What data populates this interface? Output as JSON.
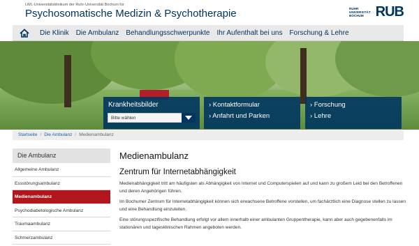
{
  "header": {
    "institution": "LWL-Universitätsklinikum der Ruhr-Universität Bochum für",
    "title": "Psychosomatische Medizin & Psychotherapie",
    "logo_small": "RUHR UNIVERSITÄT BOCHUM",
    "logo_big": "RUB"
  },
  "nav": {
    "home_icon": "home-icon",
    "items": [
      "Die Klinik",
      "Die Ambulanz",
      "Behandlungsschwerpunkte",
      "Ihr Aufenthalt bei uns",
      "Forschung & Lehre"
    ]
  },
  "hero": {
    "box1": {
      "label": "Krankheitsbilder",
      "select_value": "Bitte wählen"
    },
    "box2": [
      "› Kontaktformular",
      "› Anfahrt und Parken"
    ],
    "box3": [
      "› Forschung",
      "› Lehre"
    ]
  },
  "breadcrumb": [
    "Startseite",
    "Die Ambulanz",
    "Medienambulanz"
  ],
  "sidebar": {
    "title": "Die Ambulanz",
    "items": [
      {
        "label": "Allgemeine Ambulanz",
        "active": false
      },
      {
        "label": "Essstörungsambulanz",
        "active": false
      },
      {
        "label": "Medienambulanz",
        "active": true
      },
      {
        "label": "Psychodiabetologische Ambulanz",
        "active": false
      },
      {
        "label": "Traumaambulanz",
        "active": false
      },
      {
        "label": "Schmerzambulanz",
        "active": false
      }
    ]
  },
  "main": {
    "title": "Medienambulanz",
    "subtitle": "Zentrum für Internetabhängigkeit",
    "paragraphs": [
      "Medienabhängigkeit tritt am häufigsten als Abhängigkeit von Internet und Computerspielen auf und kann zu großem Leid bei den Betroffenen und deren Angehörigen führen.",
      "Im Bochumer Zentrum für Internetabhängigkeit können sich erwachsene Betroffene vorstellen, um fachärztlich eine Diagnose stellen zu lassen und eine Behandlung einzuleiten.",
      "Eine störungsspezifische Behandlung erfolgt vor allem innerhalb einer ambulanten Gruppentherapie, kann aber auch gegebenenfalls im stationären und tagesklinischen Rahmen angeboten werden."
    ]
  },
  "colors": {
    "brand": "#003560",
    "active": "#b2161d",
    "nav_bg": "#e9e9e9"
  }
}
